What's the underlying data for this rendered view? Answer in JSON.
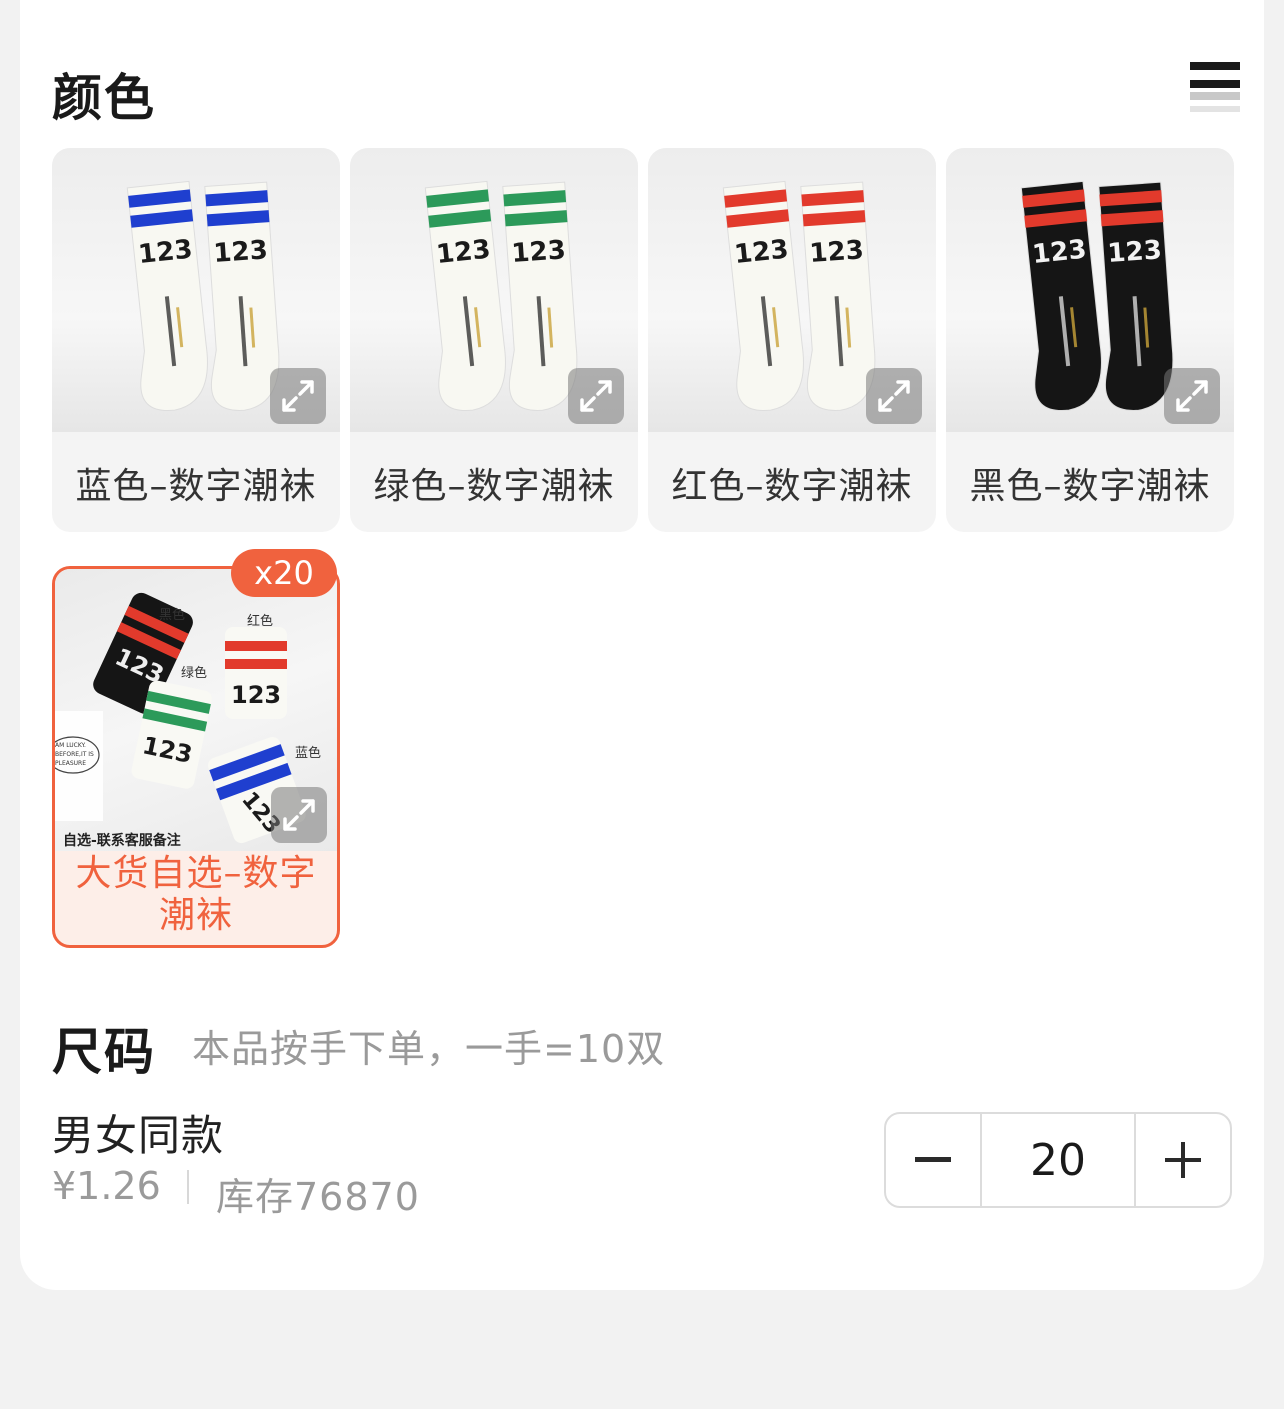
{
  "color_section": {
    "title": "颜色",
    "options": [
      {
        "label": "蓝色–数字潮袜",
        "stripe": "#1f3fcf",
        "sock": "#f8f8f2",
        "num": "#1a1a1a",
        "sock_text": "123"
      },
      {
        "label": "绿色–数字潮袜",
        "stripe": "#2c9a5a",
        "sock": "#f8f8f2",
        "num": "#1a1a1a",
        "sock_text": "123"
      },
      {
        "label": "红色–数字潮袜",
        "stripe": "#e23a2c",
        "sock": "#f8f8f2",
        "num": "#1a1a1a",
        "sock_text": "123"
      },
      {
        "label": "黑色–数字潮袜",
        "stripe": "#e23a2c",
        "sock": "#151515",
        "num": "#f2f2f2",
        "sock_text": "123"
      }
    ],
    "bulk_option": {
      "label_line1": "大货自选–数字",
      "label_line2": "潮袜",
      "badge": "x20",
      "image_caption": "自选-联系客服备注",
      "image_tags": [
        "黑色",
        "红色",
        "绿色",
        "蓝色"
      ],
      "note_card_lines": [
        "AM LUCKY.",
        "BEFORE,IT IS",
        "PLEASURE"
      ],
      "sock_text": "123",
      "selected": true
    }
  },
  "size_section": {
    "title": "尺码",
    "note": "本品按手下单，一手=10双",
    "sku": {
      "name": "男女同款",
      "price": "¥1.26",
      "stock": "库存76870",
      "quantity": "20",
      "minus_symbol": "−",
      "plus_symbol": "+"
    }
  },
  "colors": {
    "accent": "#f0623e",
    "muted_text": "#9a9a9a"
  },
  "icons": {
    "view_toggle": "list-view-icon",
    "expand": "expand-arrows-icon"
  }
}
